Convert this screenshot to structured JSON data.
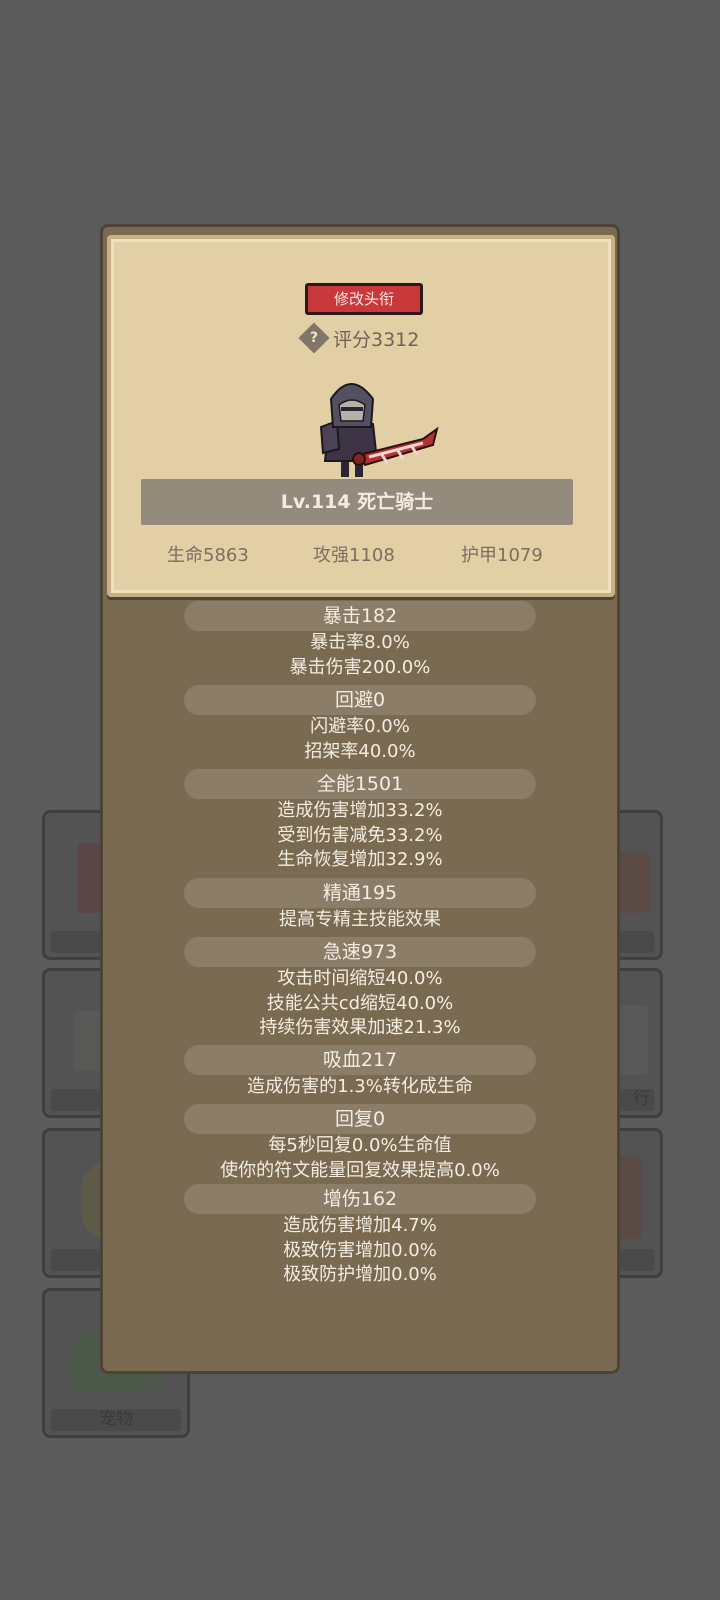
{
  "background_tabs": {
    "pet_label": "宠物",
    "partial_right_label": "行"
  },
  "card": {
    "title_button": "修改头衔",
    "score": "评分3312",
    "hero_name": "Lv.114 死亡骑士",
    "hp": "生命5863",
    "attack": "攻强1108",
    "armor": "护甲1079"
  },
  "attributes": [
    {
      "header": "暴击182",
      "lines": [
        "暴击率8.0%",
        "暴击伤害200.0%"
      ]
    },
    {
      "header": "回避0",
      "lines": [
        "闪避率0.0%",
        "招架率40.0%"
      ]
    },
    {
      "header": "全能1501",
      "lines": [
        "造成伤害增加33.2%",
        "受到伤害减免33.2%",
        "生命恢复增加32.9%"
      ]
    },
    {
      "header": "精通195",
      "lines": [
        "提高专精主技能效果"
      ]
    },
    {
      "header": "急速973",
      "lines": [
        "攻击时间缩短40.0%",
        "技能公共cd缩短40.0%",
        "持续伤害效果加速21.3%"
      ]
    },
    {
      "header": "吸血217",
      "lines": [
        "造成伤害的1.3%转化成生命"
      ]
    },
    {
      "header": "回复0",
      "lines": [
        "每5秒回复0.0%生命值",
        "使你的符文能量回复效果提高0.0%"
      ]
    },
    {
      "header": "增伤162",
      "lines": [
        "造成伤害增加4.7%",
        "极致伤害增加0.0%",
        "极致防护增加0.0%"
      ]
    }
  ],
  "colors": {
    "background": "#5b5b5b",
    "panel": "#7a6a52",
    "card": "#e3cfa5",
    "title_button": "#c9383a",
    "name_plate": "#958b7c"
  }
}
